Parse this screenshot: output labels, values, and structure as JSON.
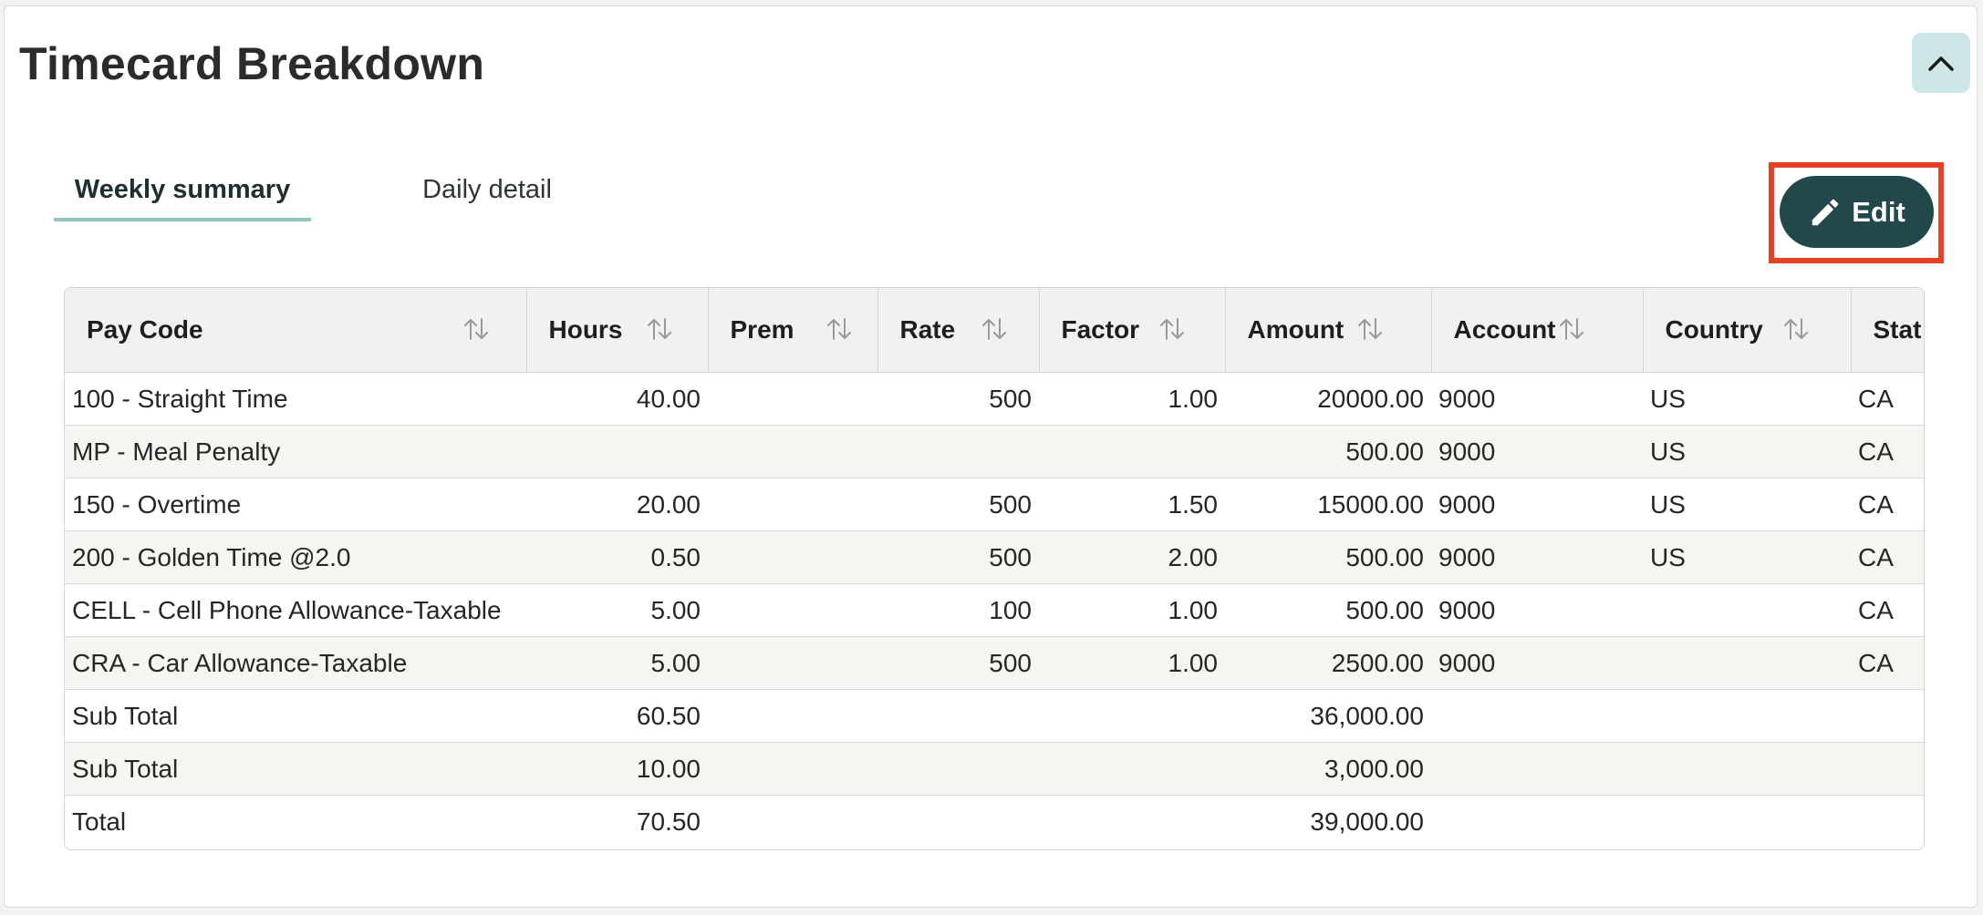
{
  "panel": {
    "title": "Timecard Breakdown"
  },
  "tabs": [
    {
      "label": "Weekly summary",
      "active": true
    },
    {
      "label": "Daily detail",
      "active": false
    }
  ],
  "edit_button": {
    "label": "Edit"
  },
  "table": {
    "columns": [
      "Pay Code",
      "Hours",
      "Prem",
      "Rate",
      "Factor",
      "Amount",
      "Account",
      "Country",
      "Stat"
    ],
    "rows": [
      [
        "100 - Straight Time",
        "40.00",
        "",
        "500",
        "1.00",
        "20000.00",
        "9000",
        "US",
        "CA"
      ],
      [
        "MP - Meal Penalty",
        "",
        "",
        "",
        "",
        "500.00",
        "9000",
        "US",
        "CA"
      ],
      [
        "150 - Overtime",
        "20.00",
        "",
        "500",
        "1.50",
        "15000.00",
        "9000",
        "US",
        "CA"
      ],
      [
        "200 - Golden Time @2.0",
        "0.50",
        "",
        "500",
        "2.00",
        "500.00",
        "9000",
        "US",
        "CA"
      ],
      [
        "CELL - Cell Phone Allowance-Taxable",
        "5.00",
        "",
        "100",
        "1.00",
        "500.00",
        "9000",
        "",
        "CA"
      ],
      [
        "CRA - Car Allowance-Taxable",
        "5.00",
        "",
        "500",
        "1.00",
        "2500.00",
        "9000",
        "",
        "CA"
      ],
      [
        "Sub Total",
        "60.50",
        "",
        "",
        "",
        "36,000.00",
        "",
        "",
        ""
      ],
      [
        "Sub Total",
        "10.00",
        "",
        "",
        "",
        "3,000.00",
        "",
        "",
        ""
      ],
      [
        "Total",
        "70.50",
        "",
        "",
        "",
        "39,000.00",
        "",
        "",
        ""
      ]
    ]
  },
  "colors": {
    "accent": "#22484b",
    "tab_underline": "#8fc7c4",
    "highlight": "#e64027"
  }
}
